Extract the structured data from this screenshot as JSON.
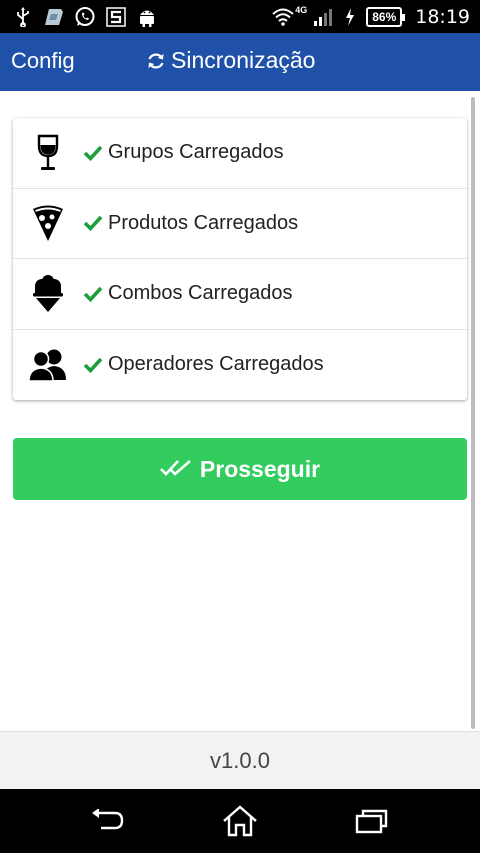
{
  "status_bar": {
    "icons_left": [
      "usb-icon",
      "sim-card-icon",
      "whatsapp-icon",
      "s-app-icon",
      "android-icon"
    ],
    "network_type": "4G",
    "battery": "86%",
    "time": "18:19"
  },
  "app_bar": {
    "config_label": "Config",
    "title": "Sincronização",
    "title_icon": "sync-icon",
    "background": "#1f51a8"
  },
  "sync_list": {
    "items": [
      {
        "label": "Grupos Carregados",
        "icon": "wine-glass-icon",
        "status_icon": "check-icon"
      },
      {
        "label": "Produtos Carregados",
        "icon": "pizza-slice-icon",
        "status_icon": "check-icon"
      },
      {
        "label": "Combos Carregados",
        "icon": "ice-cream-icon",
        "status_icon": "check-icon"
      },
      {
        "label": "Operadores Carregados",
        "icon": "users-icon",
        "status_icon": "check-icon"
      }
    ],
    "check_color": "#1e9e3a"
  },
  "proceed_button": {
    "label": "Prosseguir",
    "icon": "double-check-icon",
    "background": "#33cc5f"
  },
  "footer": {
    "version": "v1.0.0"
  },
  "nav_bar": {
    "buttons": [
      "back-icon",
      "home-icon",
      "recent-apps-icon"
    ]
  }
}
